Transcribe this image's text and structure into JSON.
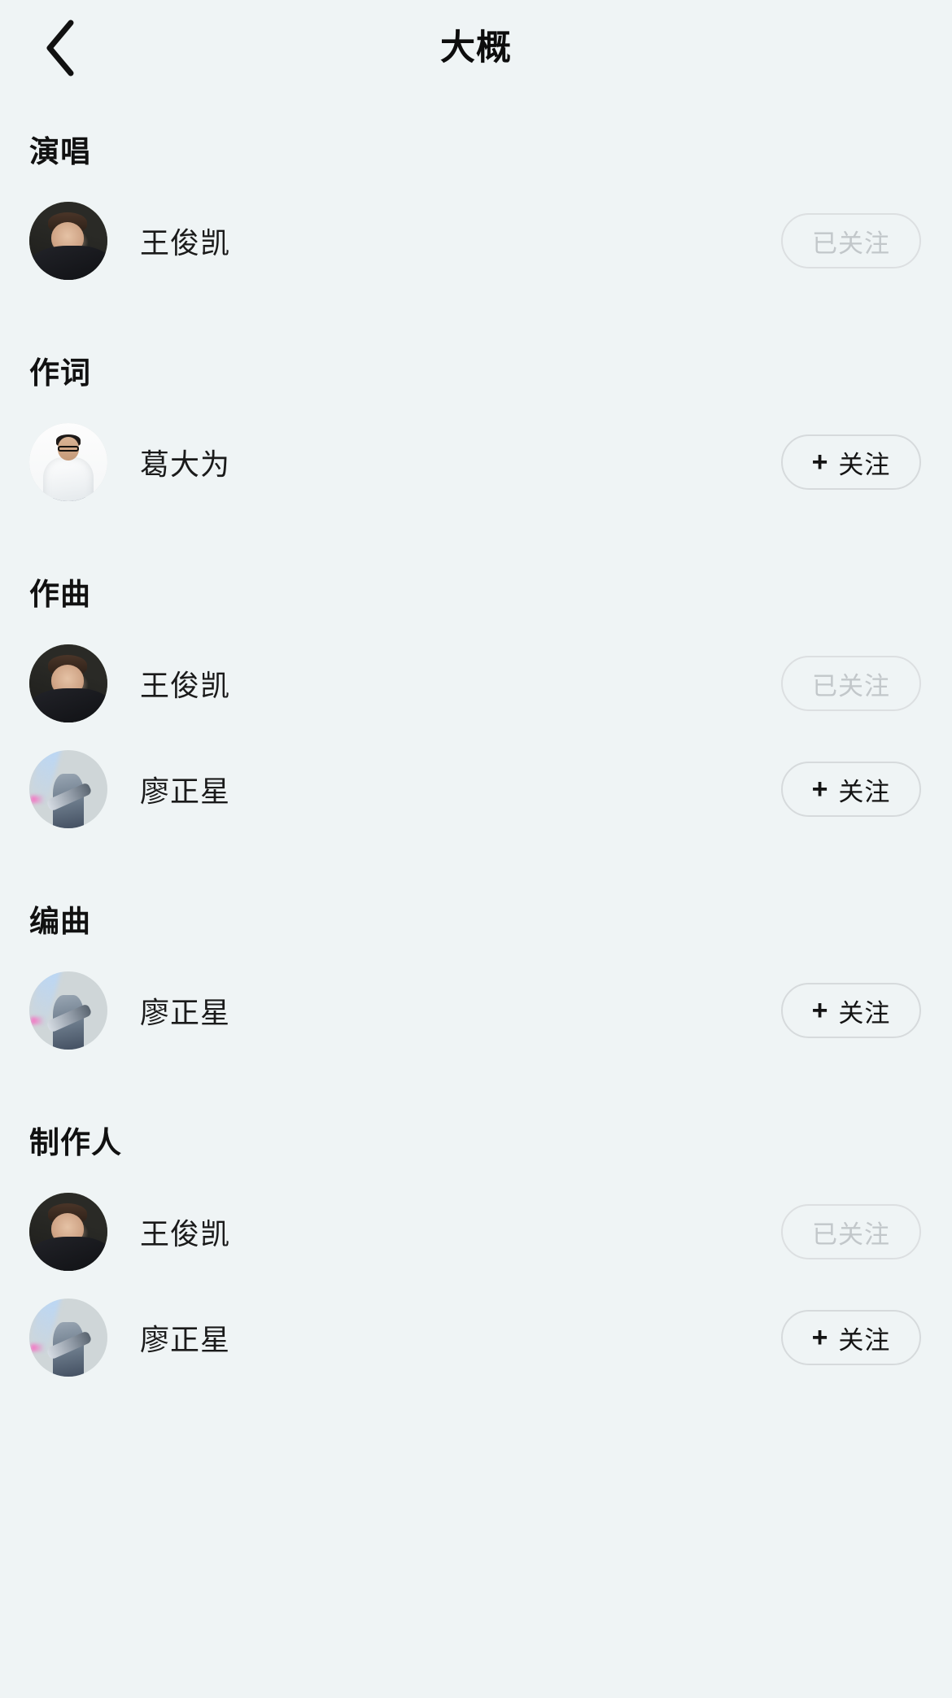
{
  "header": {
    "title": "大概",
    "back_icon": "chevron-left-icon"
  },
  "labels": {
    "following": "已关注",
    "follow": "关注",
    "follow_plus": "+"
  },
  "colors": {
    "background": "#eff4f5",
    "text_primary": "#1a1a1a",
    "text_muted": "#c2c7ca",
    "border": "#d6dadc"
  },
  "sections": [
    {
      "title": "演唱",
      "people": [
        {
          "name": "王俊凯",
          "avatar": "wang-junkai-photo",
          "followed": true,
          "button": "已关注"
        }
      ]
    },
    {
      "title": "作词",
      "people": [
        {
          "name": "葛大为",
          "avatar": "ge-dawei-photo",
          "followed": false,
          "button": "关注"
        }
      ]
    },
    {
      "title": "作曲",
      "people": [
        {
          "name": "王俊凯",
          "avatar": "wang-junkai-photo",
          "followed": true,
          "button": "已关注"
        },
        {
          "name": "廖正星",
          "avatar": "liao-zhengxing-photo",
          "followed": false,
          "button": "关注"
        }
      ]
    },
    {
      "title": "编曲",
      "people": [
        {
          "name": "廖正星",
          "avatar": "liao-zhengxing-photo",
          "followed": false,
          "button": "关注"
        }
      ]
    },
    {
      "title": "制作人",
      "people": [
        {
          "name": "王俊凯",
          "avatar": "wang-junkai-photo",
          "followed": true,
          "button": "已关注"
        },
        {
          "name": "廖正星",
          "avatar": "liao-zhengxing-photo",
          "followed": false,
          "button": "关注"
        }
      ]
    }
  ]
}
